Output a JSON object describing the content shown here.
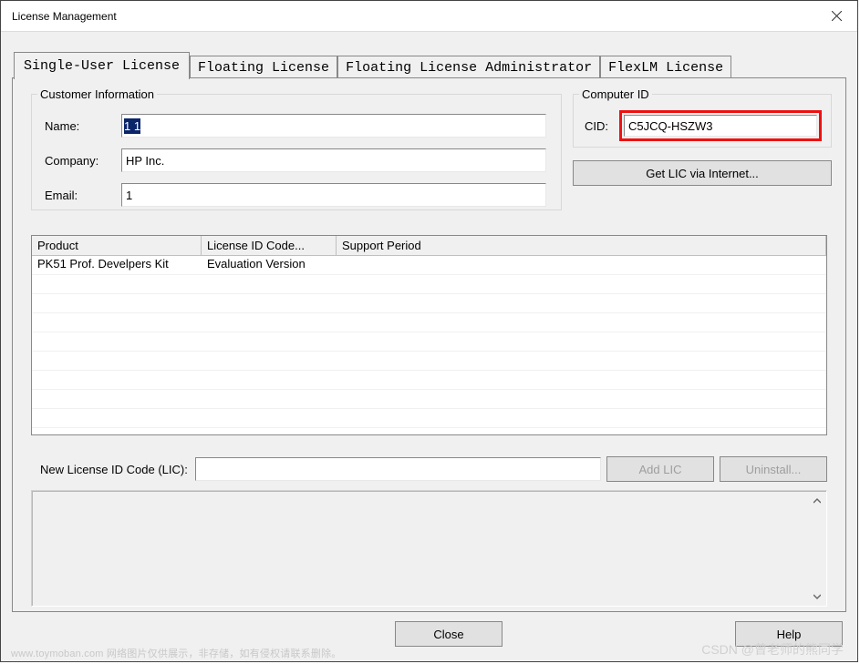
{
  "window": {
    "title": "License Management"
  },
  "tabs": [
    {
      "label": "Single-User License",
      "active": true
    },
    {
      "label": "Floating License",
      "active": false
    },
    {
      "label": "Floating License Administrator",
      "active": false
    },
    {
      "label": "FlexLM License",
      "active": false
    }
  ],
  "customer": {
    "legend": "Customer Information",
    "name_label": "Name:",
    "name_value": "1 1",
    "company_label": "Company:",
    "company_value": "HP Inc.",
    "email_label": "Email:",
    "email_value": "1"
  },
  "computer": {
    "legend": "Computer ID",
    "cid_label": "CID:",
    "cid_value": "C5JCQ-HSZW3",
    "get_lic_label": "Get LIC via Internet..."
  },
  "grid": {
    "headers": {
      "product": "Product",
      "lic": "License ID Code...",
      "support": "Support Period"
    },
    "rows": [
      {
        "product": "PK51 Prof. Develpers Kit",
        "lic": "Evaluation Version",
        "support": ""
      }
    ]
  },
  "lic_entry": {
    "label": "New License ID Code (LIC):",
    "value": "",
    "add_label": "Add LIC",
    "uninstall_label": "Uninstall..."
  },
  "footer": {
    "close": "Close",
    "help": "Help"
  },
  "watermark": {
    "left": "www.toymoban.com 网络图片仅供展示，非存储，如有侵权请联系删除。",
    "right": "CSDN @曾老师的熊同学"
  }
}
